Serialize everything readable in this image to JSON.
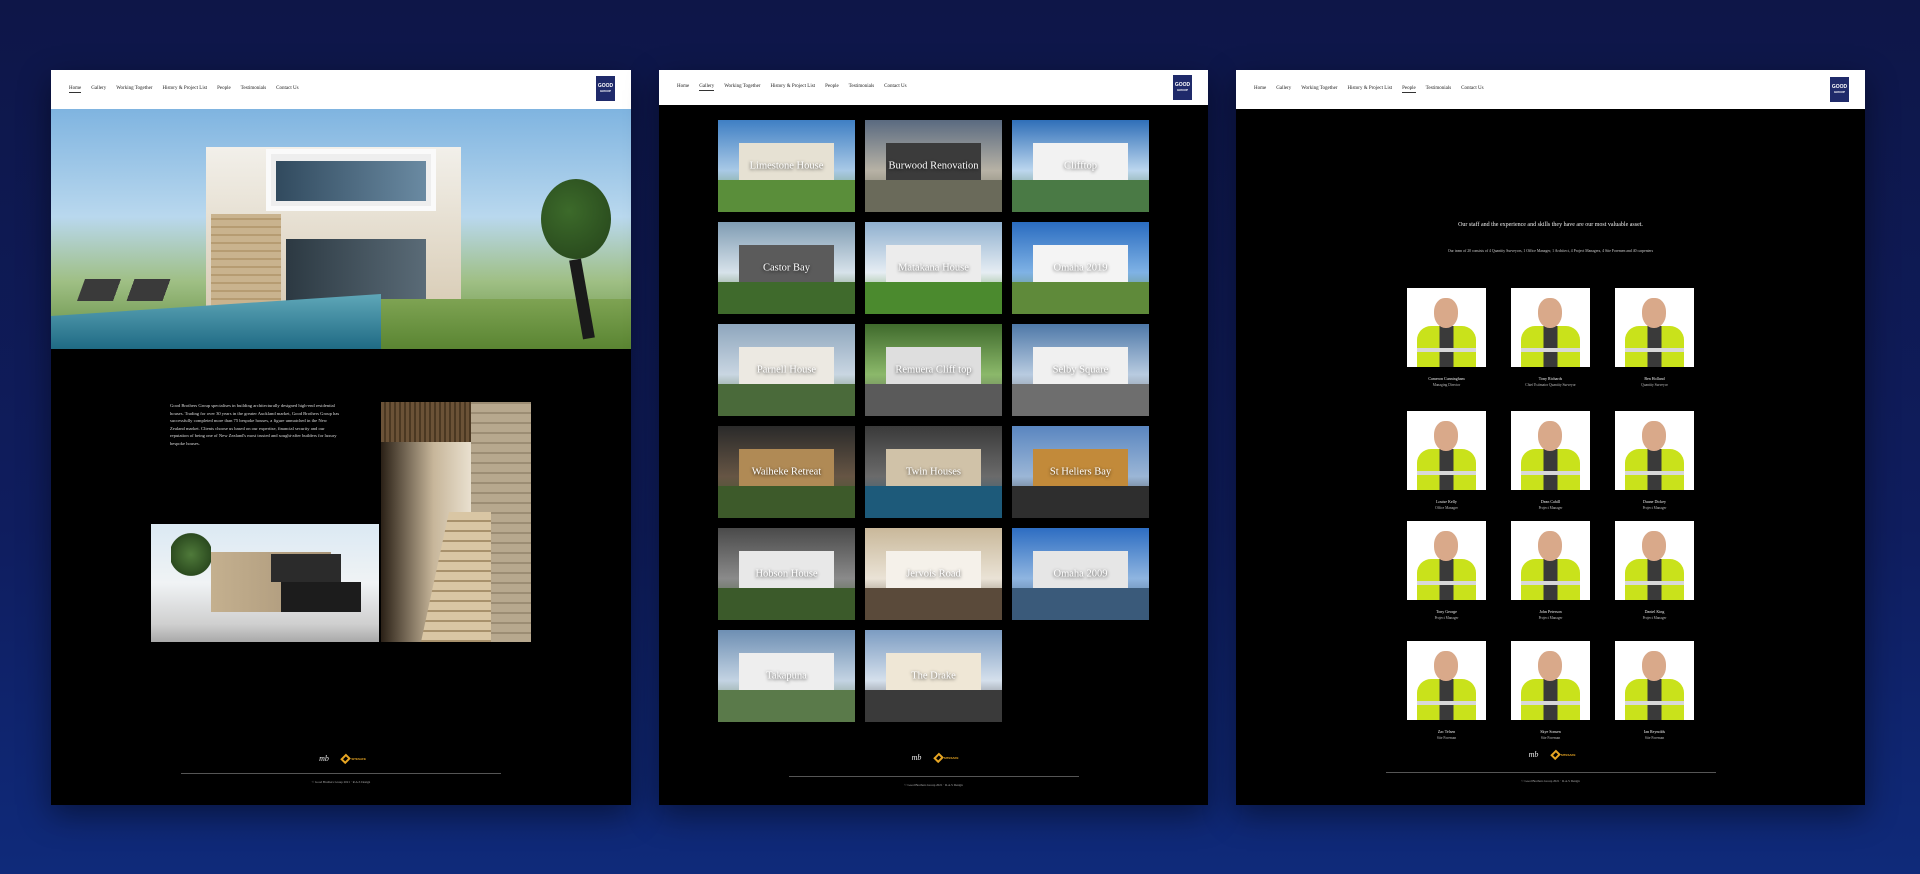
{
  "colors": {
    "accent_blue": "#1f2a6a",
    "background": "#0f1d5e",
    "vest_yellow": "#c9e21b",
    "safe_orange": "#e8a623"
  },
  "nav": {
    "home": [
      "Home",
      "Gallery",
      "Working Together",
      "History & Project List",
      "People",
      "Testimonials",
      "Contact Us"
    ],
    "gallery": [
      "Home",
      "Gallery",
      "Working Together",
      "History & Project List",
      "People",
      "Testimonials",
      "Contact Us"
    ],
    "people": [
      "Home",
      "Gallery",
      "Working Together",
      "History & Project List",
      "People",
      "Testimonials",
      "Contact Us"
    ]
  },
  "logo": {
    "line1": "GOOD",
    "line2": "GROUP"
  },
  "home": {
    "intro": "Good Brothers Group specialises in building architecturally designed high-end residential houses. Trading for over 30 years in the greater Auckland market, Good Brothers Group has successfully completed more than 75 bespoke houses, a figure unmatched in the New Zealand market. Clients choose us based on our expertise, financial security and our reputation of being one of New Zealand's most trusted and sought-after builders for luxury bespoke houses."
  },
  "gallery": {
    "tiles": [
      "Limestone House",
      "Burwood Renovation",
      "Clifftop",
      "Castor Bay",
      "Matakana House",
      "Omaha 2019",
      "Parnell House",
      "Remuera Cliff top",
      "Selby Square",
      "Waiheke Retreat",
      "Twin Houses",
      "St Heliers Bay",
      "Hobson House",
      "Jervois Road",
      "Omaha 2009",
      "Takapuna",
      "The Drake"
    ]
  },
  "people": {
    "tagline": "Our staff and the experience and skills they have are our most valuable asset.",
    "sub": "Our team of 20 consists of 4 Quantity Surveyors, 1 Office Manager, 1 Architect, 4 Project Managers, 4 Site Foremen and 40 carpenters",
    "staff": [
      {
        "name": "Cameron Cunningham",
        "role": "Managing Director"
      },
      {
        "name": "Tony Richards",
        "role": "Chief Estimator Quantity Surveyor"
      },
      {
        "name": "Ben Holland",
        "role": "Quantity Surveyor"
      },
      {
        "name": "Louise Kelly",
        "role": "Office Manager"
      },
      {
        "name": "Dean Cahill",
        "role": "Project Manager"
      },
      {
        "name": "Duane Dickey",
        "role": "Project Manager"
      },
      {
        "name": "Tony George",
        "role": "Project Manager"
      },
      {
        "name": "John Peterson",
        "role": "Project Manager"
      },
      {
        "name": "Daniel King",
        "role": "Project Manager"
      },
      {
        "name": "Zac Telsen",
        "role": "Site Foreman"
      },
      {
        "name": "Skye Sonsen",
        "role": "Site Foreman"
      },
      {
        "name": "Ian Reynolds",
        "role": "Site Foreman"
      }
    ]
  },
  "footer": {
    "mb_mark": "mb",
    "safe_mark": "SITESAFE",
    "copyright": "© Good Brothers Group 2021 · R.A.S Design"
  }
}
